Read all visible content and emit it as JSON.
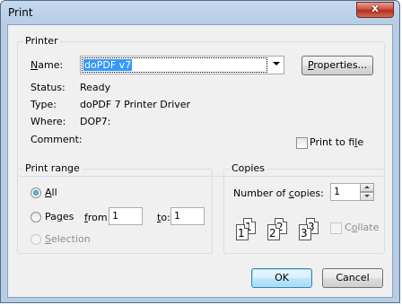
{
  "window": {
    "title": "Print",
    "close_glyph": "x"
  },
  "printer": {
    "group_title": "Printer",
    "name_label": "Name:",
    "name_value": "doPDF v7",
    "properties_button": "Properties...",
    "status_label": "Status:",
    "status_value": "Ready",
    "type_label": "Type:",
    "type_value": "doPDF 7 Printer Driver",
    "where_label": "Where:",
    "where_value": "DOP7:",
    "comment_label": "Comment:",
    "print_to_file_label": "Print to file",
    "print_to_file_checked": false
  },
  "print_range": {
    "group_title": "Print range",
    "all_label": "All",
    "pages_label": "Pages",
    "from_label": "from:",
    "from_value": "1",
    "to_label": "to:",
    "to_value": "1",
    "selection_label": "Selection",
    "selected_option": "All"
  },
  "copies": {
    "group_title": "Copies",
    "number_label": "Number of copies:",
    "number_value": "1",
    "collate_label": "Collate",
    "collate_checked": false,
    "collate_icon_digits": [
      "1",
      "1",
      "2",
      "2",
      "3",
      "3"
    ]
  },
  "buttons": {
    "ok": "OK",
    "cancel": "Cancel"
  },
  "colors": {
    "title_bar": "#b9d1ea",
    "close_button": "#c7473a",
    "dialog_background": "#f0f0f0",
    "selection_highlight": "#3399ff"
  }
}
